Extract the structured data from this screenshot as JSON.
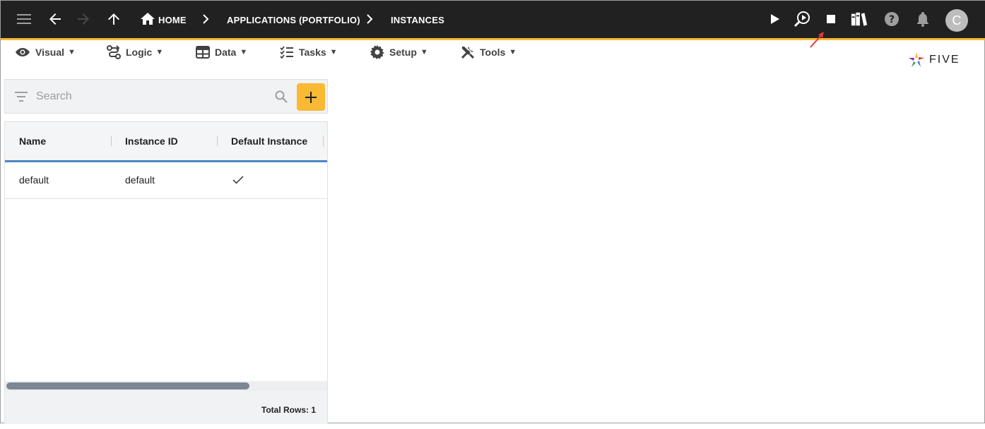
{
  "topbar": {
    "breadcrumbs": [
      "HOME",
      "APPLICATIONS (PORTFOLIO)",
      "INSTANCES"
    ],
    "avatar_initial": "C",
    "icons": [
      "menu-icon",
      "back-arrow-icon",
      "forward-arrow-icon",
      "up-arrow-icon",
      "home-icon",
      "chevron-right-icon",
      "play-icon",
      "run-search-icon",
      "stop-icon",
      "library-icon",
      "help-icon",
      "bell-icon"
    ]
  },
  "menu": {
    "items": [
      {
        "label": "Visual",
        "icon": "eye-icon"
      },
      {
        "label": "Logic",
        "icon": "logic-icon"
      },
      {
        "label": "Data",
        "icon": "table-icon"
      },
      {
        "label": "Tasks",
        "icon": "checklist-icon"
      },
      {
        "label": "Setup",
        "icon": "gear-icon"
      },
      {
        "label": "Tools",
        "icon": "tools-icon"
      }
    ],
    "caret": "▼"
  },
  "logo": {
    "text": "FIVE"
  },
  "search": {
    "placeholder": "Search"
  },
  "grid": {
    "columns": [
      "Name",
      "Instance ID",
      "Default Instance"
    ],
    "rows": [
      {
        "name": "default",
        "instance_id": "default",
        "default_instance": true
      }
    ],
    "footer": "Total Rows: 1"
  },
  "colors": {
    "topbar": "#212121",
    "accent": "#f9b934",
    "header_underline": "#4a86c5",
    "annotation": "#e53935"
  }
}
